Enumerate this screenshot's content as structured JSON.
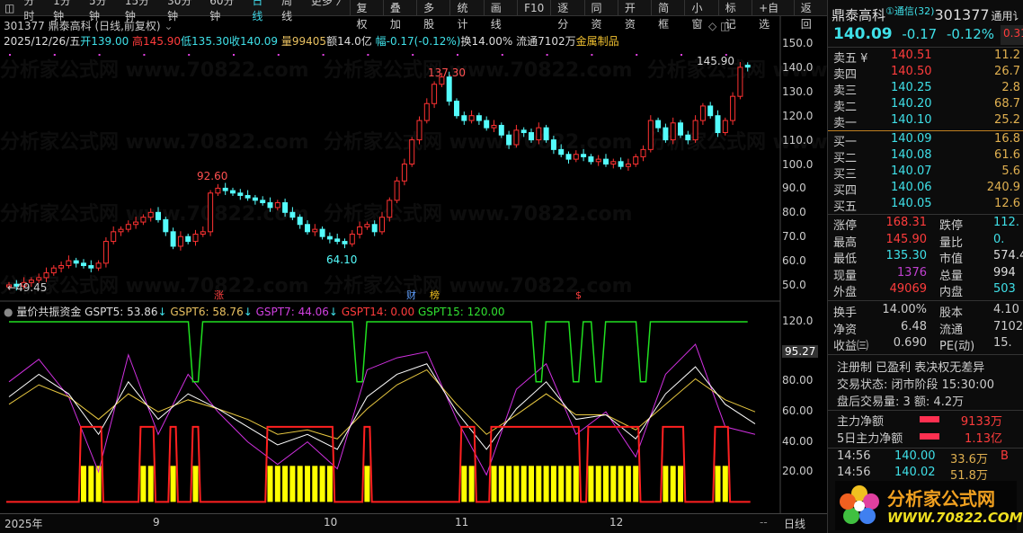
{
  "toolbar": {
    "periods": [
      "分时",
      "1分钟",
      "5分钟",
      "15分钟",
      "30分钟",
      "60分钟",
      "日线",
      "周线",
      "更多 〉"
    ],
    "active": "日线",
    "buttons": [
      "复权",
      "叠加",
      "多股",
      "统计",
      "画线",
      "F10",
      "逐分",
      "同资",
      "开资",
      "简框",
      "小窗",
      "标记",
      "+自选",
      "返回"
    ]
  },
  "header": {
    "title": "301377 鼎泰高科 (日线,前复权)",
    "date": "2025/12/26/五",
    "open": "开139.00",
    "high": "高145.90",
    "low": "低135.30",
    "close": "收140.09",
    "vol": "量99405",
    "amount": "额14.0亿",
    "change": "幅-0.17(-0.12%)",
    "turnover": "换14.00%",
    "float": "流通7102万",
    "sector": "金属制品"
  },
  "price_axis": [
    "150.0",
    "140.0",
    "130.0",
    "120.0",
    "110.0",
    "100.0",
    "90.0",
    "80.0",
    "70.0",
    "60.0",
    "50.0"
  ],
  "price_annotations": {
    "high": "137.30",
    "mid_high": "92.60",
    "low": "64.10",
    "start_low": "←49.45",
    "last_high": "145.90"
  },
  "event_markers": [
    "涨",
    "财",
    "榜",
    "$"
  ],
  "indicator": {
    "name": "量价共振资金",
    "gspt5": "GSPT5: 53.86",
    "gspt6": "GSPT6: 58.76",
    "gspt7": "GSPT7: 44.06",
    "gspt14": "GSPT14: 0.00",
    "gspt15": "GSPT15: 120.00",
    "axis": [
      "120.0",
      "80.00",
      "60.00",
      "40.00",
      "20.00"
    ],
    "cursor_value": "95.27"
  },
  "date_axis": {
    "labels": [
      "2025年",
      "9",
      "10",
      "11",
      "12"
    ],
    "period": "日线",
    "nav": "--"
  },
  "colors": {
    "up": "#ff3232",
    "down": "#54fcfc",
    "gspt5": "#ffffff",
    "gspt6": "#e8c840",
    "gspt7": "#d030e0",
    "gspt14": "#ff2020",
    "gspt15": "#20e020",
    "bars": "#ffff00"
  },
  "chart_data": {
    "type": "candlestick",
    "closes": [
      50,
      49.5,
      51,
      52,
      53,
      55,
      57,
      58,
      60,
      59,
      58,
      57,
      59,
      68,
      72,
      73,
      75,
      76,
      78,
      80,
      77,
      72,
      66,
      70,
      68,
      71,
      72,
      88,
      90,
      89,
      88,
      87,
      86,
      85,
      84,
      82,
      84,
      80,
      78,
      75,
      72,
      73,
      70,
      69,
      68,
      67,
      71,
      74,
      75,
      72,
      78,
      85,
      93,
      100,
      110,
      118,
      125,
      133,
      136,
      126,
      120,
      118,
      120,
      118,
      115,
      116,
      112,
      108,
      114,
      113,
      110,
      115,
      110,
      106,
      104,
      102,
      104,
      103,
      101,
      102,
      100,
      101,
      99,
      100,
      103,
      106,
      118,
      115,
      110,
      117,
      112,
      110,
      118,
      124,
      120,
      113,
      118,
      128,
      140,
      140.09
    ],
    "price_range": [
      45,
      152
    ],
    "indicator_range": [
      0,
      125
    ],
    "gspt7": [
      80,
      95,
      70,
      20,
      98,
      45,
      85,
      60,
      40,
      25,
      40,
      22,
      88,
      96,
      100,
      55,
      18,
      75,
      92,
      45,
      60,
      30,
      85,
      105,
      50,
      45
    ],
    "gspt5": [
      70,
      85,
      72,
      45,
      80,
      55,
      72,
      62,
      50,
      38,
      45,
      35,
      70,
      85,
      92,
      60,
      35,
      62,
      80,
      55,
      58,
      42,
      72,
      90,
      65,
      52
    ],
    "gspt6": [
      65,
      78,
      70,
      55,
      72,
      60,
      68,
      62,
      55,
      45,
      48,
      42,
      62,
      78,
      88,
      65,
      45,
      58,
      72,
      58,
      58,
      48,
      65,
      82,
      68,
      60
    ],
    "gspt14_high_ranges": [
      [
        10,
        12
      ],
      [
        18,
        19
      ],
      [
        22,
        22
      ],
      [
        25,
        25
      ],
      [
        35,
        43
      ],
      [
        48,
        48
      ],
      [
        61,
        62
      ],
      [
        65,
        71
      ],
      [
        72,
        76
      ],
      [
        78,
        84
      ],
      [
        88,
        90
      ],
      [
        95,
        96
      ]
    ],
    "gspt14_levels": [
      0,
      50
    ],
    "bar_level": 24,
    "gspt15_dips": [
      25,
      47,
      71,
      76,
      79,
      85
    ],
    "gspt15_levels": [
      120,
      80
    ]
  },
  "panel": {
    "name": "鼎泰高科",
    "industry": "①通信(32)",
    "code": "301377",
    "tag": "通用讠",
    "price": "140.09",
    "chg": "-0.17",
    "pct": "-0.12%",
    "side": "0.31",
    "sells": [
      {
        "l": "卖五 ¥",
        "p": "140.51",
        "v": "11.2",
        "pc": "red"
      },
      {
        "l": "卖四",
        "p": "140.50",
        "v": "26.7",
        "pc": "red"
      },
      {
        "l": "卖三",
        "p": "140.25",
        "v": "2.8",
        "pc": "cyan"
      },
      {
        "l": "卖二",
        "p": "140.20",
        "v": "68.7",
        "pc": "cyan"
      },
      {
        "l": "卖一",
        "p": "140.10",
        "v": "25.2",
        "pc": "cyan"
      }
    ],
    "buys": [
      {
        "l": "买一",
        "p": "140.09",
        "v": "16.8"
      },
      {
        "l": "买二",
        "p": "140.08",
        "v": "61.6"
      },
      {
        "l": "买三",
        "p": "140.07",
        "v": "5.6"
      },
      {
        "l": "买四",
        "p": "140.06",
        "v": "240.9"
      },
      {
        "l": "买五",
        "p": "140.05",
        "v": "12.6"
      }
    ],
    "stats": [
      [
        "涨停",
        "168.31",
        "red",
        "跌停",
        "112.",
        "cyan"
      ],
      [
        "最高",
        "145.90",
        "red",
        "量比",
        "0.",
        "cyan"
      ],
      [
        "最低",
        "135.30",
        "cyan",
        "市值",
        "574.4",
        "wht"
      ],
      [
        "现量",
        "1376",
        "mag",
        "总量",
        "994",
        "wht"
      ],
      [
        "外盘",
        "49069",
        "red",
        "内盘",
        "503",
        "cyan"
      ]
    ],
    "stats2": [
      [
        "换手",
        "14.00%",
        "股本",
        "4.10"
      ],
      [
        "净资",
        "6.48",
        "流通",
        "7102"
      ],
      [
        "收益㈢",
        "0.690",
        "PE(动)",
        "15."
      ]
    ],
    "notes": [
      "注册制 已盈利 表决权无差异",
      "交易状态: 闭市阶段 15:30:00",
      "盘后交易量: 3  额: 4.2万"
    ],
    "fund": [
      {
        "l": "主力净额",
        "v": "9133万"
      },
      {
        "l": "5日主力净额",
        "v": "1.13亿"
      }
    ],
    "ticks": [
      {
        "t": "14:56",
        "p": "140.00",
        "v": "33.6万",
        "s": "B"
      },
      {
        "t": "14:56",
        "p": "140.02",
        "v": "51.8万",
        "s": ""
      }
    ],
    "logo": {
      "cn": "分析家公式网",
      "url": "WWW.70822.COM"
    }
  },
  "watermark": "分析家公式网 www.70822.com"
}
